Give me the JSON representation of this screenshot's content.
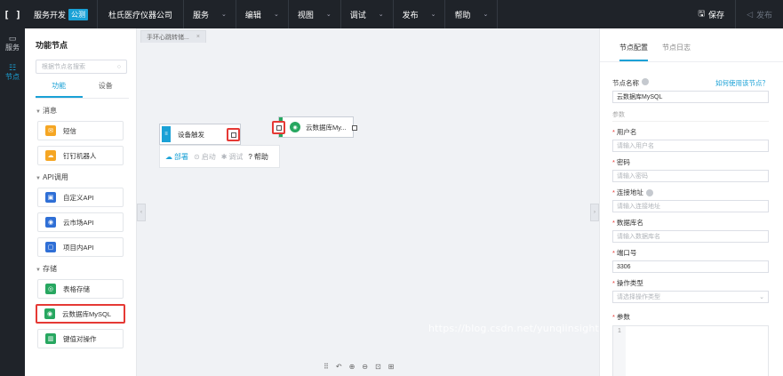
{
  "topbar": {
    "logo": "[ ]",
    "brand": "服务开发",
    "badge": "公测",
    "company": "杜氏医疗仪器公司",
    "menus": [
      "服务",
      "编辑",
      "视图",
      "调试",
      "发布",
      "帮助"
    ],
    "save_label": "保存",
    "publish_label": "发布"
  },
  "rail": {
    "items": [
      {
        "label": "服务",
        "icon": "document-icon"
      },
      {
        "label": "节点",
        "icon": "node-icon"
      }
    ]
  },
  "nodepanel": {
    "title": "功能节点",
    "search_placeholder": "根据节点名搜索",
    "tabs": [
      "功能",
      "设备"
    ],
    "groups": [
      {
        "name": "消息",
        "items": [
          {
            "label": "短信",
            "color": "#f5a623"
          },
          {
            "label": "钉钉机器人",
            "color": "#f5a623"
          }
        ]
      },
      {
        "name": "API调用",
        "items": [
          {
            "label": "自定义API",
            "color": "#2f6fd6"
          },
          {
            "label": "云市场API",
            "color": "#2f6fd6"
          },
          {
            "label": "项目内API",
            "color": "#2f6fd6"
          }
        ]
      },
      {
        "name": "存储",
        "items": [
          {
            "label": "表格存储",
            "color": "#27a760"
          },
          {
            "label": "云数据库MySQL",
            "color": "#27a760"
          },
          {
            "label": "键值对操作",
            "color": "#27a760"
          }
        ]
      }
    ]
  },
  "canvas": {
    "tab_label": "手环心跳转储...",
    "trigger_node": "设备触发",
    "mysql_node": "云数据库My...",
    "popup": {
      "deploy": "部署",
      "start": "启动",
      "debug": "调试",
      "help": "帮助"
    },
    "watermark": "https://blog.csdn.net/yunqiinsight"
  },
  "rightpanel": {
    "tabs": [
      "节点配置",
      "节点日志"
    ],
    "node_name_label": "节点名称",
    "how_to_link": "如何使用该节点？",
    "node_name_value": "云数据库MySQL",
    "params_section": "参数",
    "fields": [
      {
        "label": "用户名",
        "placeholder": "请输入用户名",
        "required": true,
        "help": false
      },
      {
        "label": "密码",
        "placeholder": "请输入密码",
        "required": true,
        "help": false
      },
      {
        "label": "连接地址",
        "placeholder": "请输入连接地址",
        "required": true,
        "help": true
      },
      {
        "label": "数据库名",
        "placeholder": "请输入数据库名",
        "required": true,
        "help": false
      }
    ],
    "port_label": "端口号",
    "port_value": "3306",
    "op_type_label": "操作类型",
    "op_type_placeholder": "请选择操作类型",
    "args_label": "参数",
    "code_line": "1"
  }
}
